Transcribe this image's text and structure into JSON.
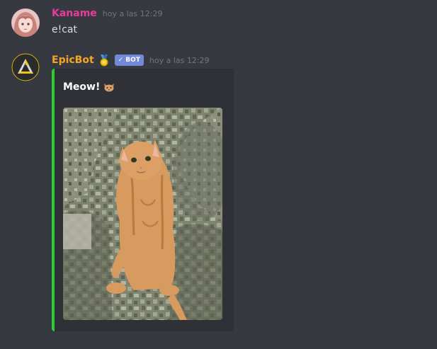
{
  "messages": [
    {
      "username": "Kaname",
      "username_color": "#e93b9f",
      "timestamp": "hoy a las 12:29",
      "text": "e!cat",
      "avatar": "anime-girl-avatar"
    },
    {
      "username": "EpicBot",
      "username_color": "#f6a623",
      "timestamp": "hoy a las 12:29",
      "badge_icon": "medal-icon",
      "bot_tag": "BOT",
      "avatar": "epicbot-logo-avatar",
      "embed": {
        "title": "Meow!",
        "title_emoji": "cat-face-icon",
        "bar_color": "#2ecc2e",
        "image": "orange-cat-photo"
      }
    }
  ]
}
